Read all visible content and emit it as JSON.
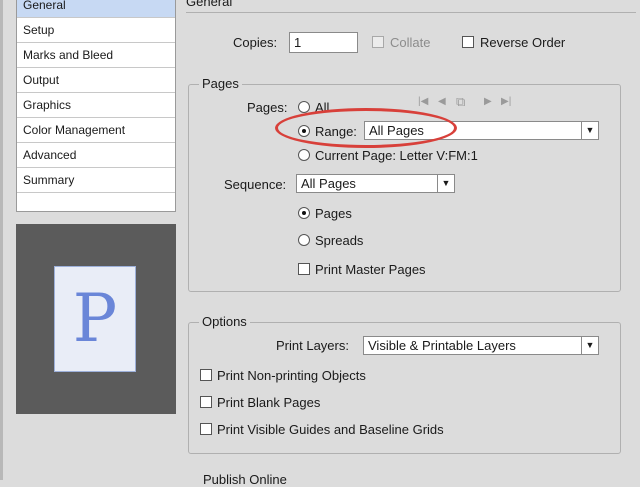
{
  "sidebar": {
    "items": [
      {
        "label": "General",
        "selected": true
      },
      {
        "label": "Setup",
        "selected": false
      },
      {
        "label": "Marks and Bleed",
        "selected": false
      },
      {
        "label": "Output",
        "selected": false
      },
      {
        "label": "Graphics",
        "selected": false
      },
      {
        "label": "Color Management",
        "selected": false
      },
      {
        "label": "Advanced",
        "selected": false
      },
      {
        "label": "Summary",
        "selected": false
      }
    ]
  },
  "preview": {
    "page_letter": "P"
  },
  "general": {
    "title": "General",
    "copies_label": "Copies:",
    "copies_value": "1",
    "collate_label": "Collate",
    "reverse_order_label": "Reverse Order"
  },
  "pages": {
    "legend": "Pages",
    "pages_label": "Pages:",
    "all_label": "All",
    "range_label": "Range:",
    "range_value": "All Pages",
    "current_page_label": "Current Page: Letter V:FM:1",
    "sequence_label": "Sequence:",
    "sequence_value": "All Pages",
    "pages_option_label": "Pages",
    "spreads_label": "Spreads",
    "print_master_pages_label": "Print Master Pages",
    "selected_range_option": "Range",
    "selected_layout_option": "Pages"
  },
  "options": {
    "legend": "Options",
    "print_layers_label": "Print Layers:",
    "print_layers_value": "Visible & Printable Layers",
    "non_printing_label": "Print Non-printing Objects",
    "blank_pages_label": "Print Blank Pages",
    "guides_label": "Print Visible Guides and Baseline Grids"
  },
  "publish": {
    "label": "Publish Online"
  },
  "colors": {
    "highlight": "#d8403a",
    "selection": "#c7d9f3",
    "preview_bg": "#5b5b5b"
  },
  "icons": [
    "first-page-icon",
    "previous-page-icon",
    "pages-icon",
    "next-page-icon",
    "last-page-icon",
    "dropdown-arrow-icon"
  ]
}
